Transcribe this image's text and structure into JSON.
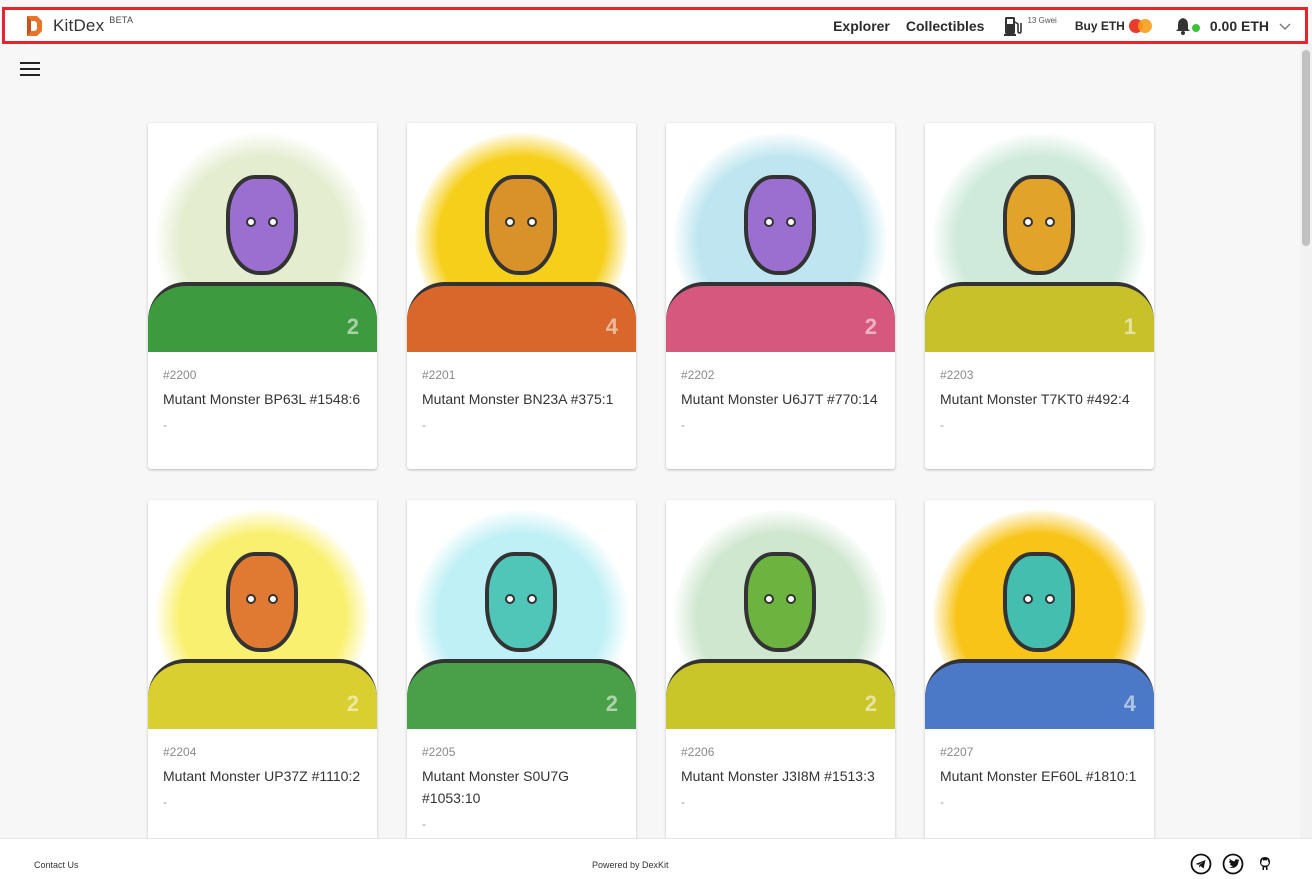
{
  "header": {
    "brand_name": "KitDex",
    "brand_badge": "BETA",
    "nav_explorer": "Explorer",
    "nav_collectibles": "Collectibles",
    "gas_label": "13 Gwei",
    "buy_label": "Buy ETH",
    "balance": "0.00 ETH",
    "accent_color": "#e8232f"
  },
  "cards": [
    {
      "token_id": "#2200",
      "title": "Mutant Monster BP63L #1548:6",
      "price": "-",
      "glow_color": "#e4edd0",
      "skin_color": "#9a6fcf",
      "body_color": "#3e9a3e",
      "level": "2"
    },
    {
      "token_id": "#2201",
      "title": "Mutant Monster BN23A #375:1",
      "price": "-",
      "glow_color": "#f6cf1a",
      "skin_color": "#d9912a",
      "body_color": "#d9662a",
      "level": "4"
    },
    {
      "token_id": "#2202",
      "title": "Mutant Monster U6J7T #770:14",
      "price": "-",
      "glow_color": "#bfe6f0",
      "skin_color": "#9a6fcf",
      "body_color": "#d7587e",
      "level": "2"
    },
    {
      "token_id": "#2203",
      "title": "Mutant Monster T7KT0 #492:4",
      "price": "-",
      "glow_color": "#cfeadb",
      "skin_color": "#e1a32a",
      "body_color": "#c8c12a",
      "level": "1"
    },
    {
      "token_id": "#2204",
      "title": "Mutant Monster UP37Z #1110:2",
      "price": "-",
      "glow_color": "#faf070",
      "skin_color": "#e07a32",
      "body_color": "#d9cf30",
      "level": "2"
    },
    {
      "token_id": "#2205",
      "title": "Mutant Monster S0U7G #1053:10",
      "price": "-",
      "glow_color": "#bff0f5",
      "skin_color": "#4fc6b8",
      "body_color": "#4aa048",
      "level": "2"
    },
    {
      "token_id": "#2206",
      "title": "Mutant Monster J3I8M #1513:3",
      "price": "-",
      "glow_color": "#cfe6cf",
      "skin_color": "#6cb33f",
      "body_color": "#c9c62a",
      "level": "2"
    },
    {
      "token_id": "#2207",
      "title": "Mutant Monster EF60L #1810:1",
      "price": "-",
      "glow_color": "#f8c418",
      "skin_color": "#44bfaf",
      "body_color": "#4c78c8",
      "level": "4"
    }
  ],
  "footer": {
    "contact": "Contact Us",
    "powered": "Powered by DexKit",
    "icons": [
      "telegram-icon",
      "twitter-icon",
      "github-icon"
    ]
  }
}
